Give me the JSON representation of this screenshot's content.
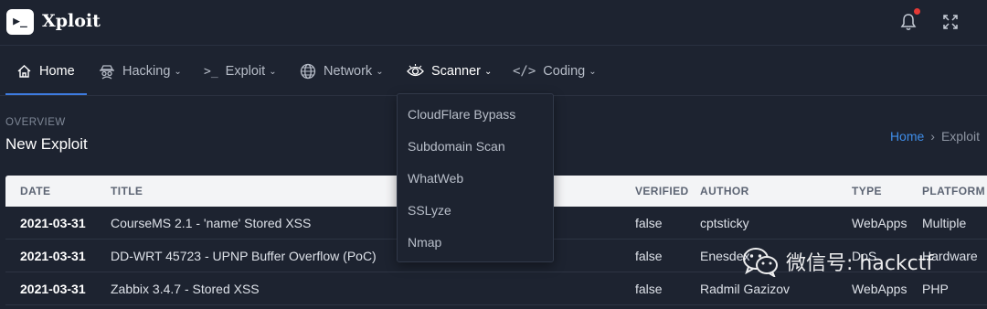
{
  "app": {
    "title": "Xploit",
    "logo_glyph": "▶_"
  },
  "header": {
    "notification_icon": "bell-icon",
    "expand_icon": "fullscreen-icon",
    "notification_dot_color": "#e53935"
  },
  "nav": {
    "items": [
      {
        "label": "Home",
        "icon": "home-icon",
        "caret": ""
      },
      {
        "label": "Hacking",
        "icon": "spy-icon",
        "caret": "⌄"
      },
      {
        "label": "Exploit",
        "icon": "terminal-icon",
        "caret": "⌄"
      },
      {
        "label": "Network",
        "icon": "globe-icon",
        "caret": "⌄"
      },
      {
        "label": "Scanner",
        "icon": "eye-icon",
        "caret": "⌄"
      },
      {
        "label": "Coding",
        "icon": "code-icon",
        "caret": "⌄"
      }
    ],
    "active_color": "#3d7be0"
  },
  "page": {
    "overview": "OVERVIEW",
    "title": "New Exploit"
  },
  "breadcrumb": {
    "home": "Home",
    "separator": "›",
    "current": "Exploit"
  },
  "dropdown": {
    "items": [
      "CloudFlare Bypass",
      "Subdomain Scan",
      "WhatWeb",
      "SSLyze",
      "Nmap"
    ]
  },
  "table": {
    "headers": [
      "DATE",
      "TITLE",
      "VERIFIED",
      "AUTHOR",
      "TYPE",
      "PLATFORM"
    ],
    "rows": [
      [
        "2021-03-31",
        "CourseMS 2.1 - 'name' Stored XSS",
        "false",
        "cptsticky",
        "WebApps",
        "Multiple"
      ],
      [
        "2021-03-31",
        "DD-WRT 45723 - UPNP Buffer Overflow (PoC)",
        "false",
        "Enesdex",
        "DoS",
        "Hardware"
      ],
      [
        "2021-03-31",
        "Zabbix 3.4.7 - Stored XSS",
        "false",
        "Radmil Gazizov",
        "WebApps",
        "PHP"
      ]
    ]
  },
  "watermark": {
    "text": "微信号: hackctf",
    "icon": "wechat-icon"
  }
}
